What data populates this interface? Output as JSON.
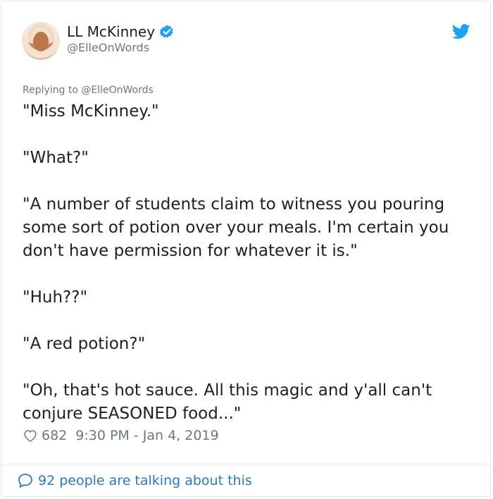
{
  "author": {
    "name": "LL McKinney",
    "handle": "@ElleOnWords",
    "verified": true
  },
  "icons": {
    "avatar": "profile-photo",
    "verified": "verified-badge-icon",
    "logo": "twitter-bird-icon",
    "like": "heart-icon",
    "conversation": "speech-bubble-icon"
  },
  "colors": {
    "twitter_blue": "#1da1f2",
    "link_blue": "#2b7bb9",
    "muted_text": "#697882",
    "border": "#e1e8ed"
  },
  "reply_context": "Replying to @ElleOnWords",
  "tweet": {
    "paragraphs": [
      "\"Miss McKinney.\"",
      "\"What?\"",
      "\"A number of students claim to witness you pouring some sort of potion over your meals. I'm certain you don't have permission for whatever it is.\"",
      "\"Huh??\"",
      "\"A red potion?\"",
      "\"Oh, that's hot sauce. All this magic and y'all can't conjure SEASONED food...\""
    ]
  },
  "meta": {
    "likes": "682",
    "timestamp": "9:30 PM - Jan 4, 2019"
  },
  "footer": {
    "talking": "92 people are talking about this"
  }
}
